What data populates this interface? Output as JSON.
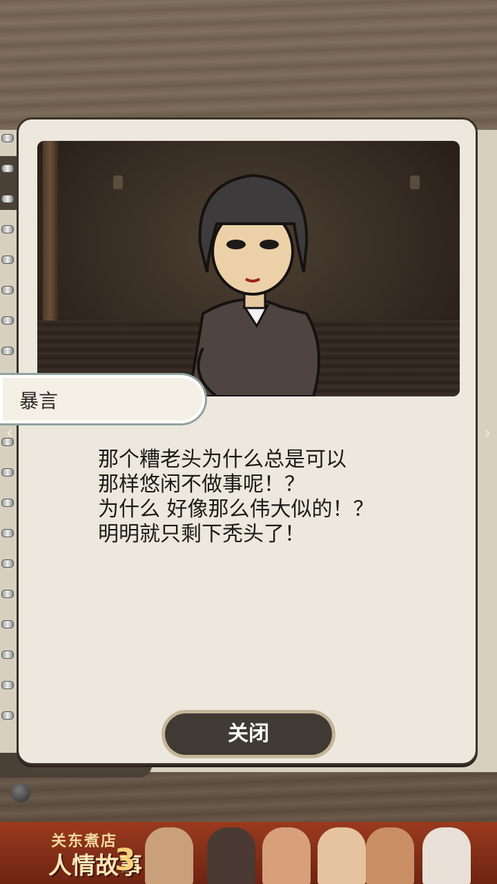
{
  "dialog": {
    "title": "暴言",
    "lines": [
      "那个糟老头为什么总是可以",
      "那样悠闲不做事呢！？",
      "为什么 好像那么伟大似的！？",
      "明明就只剩下秃头了！"
    ],
    "close_label": "关闭"
  },
  "ad": {
    "logo_top": "关东煮店",
    "logo_main": "人情故事",
    "logo_number": "3"
  }
}
